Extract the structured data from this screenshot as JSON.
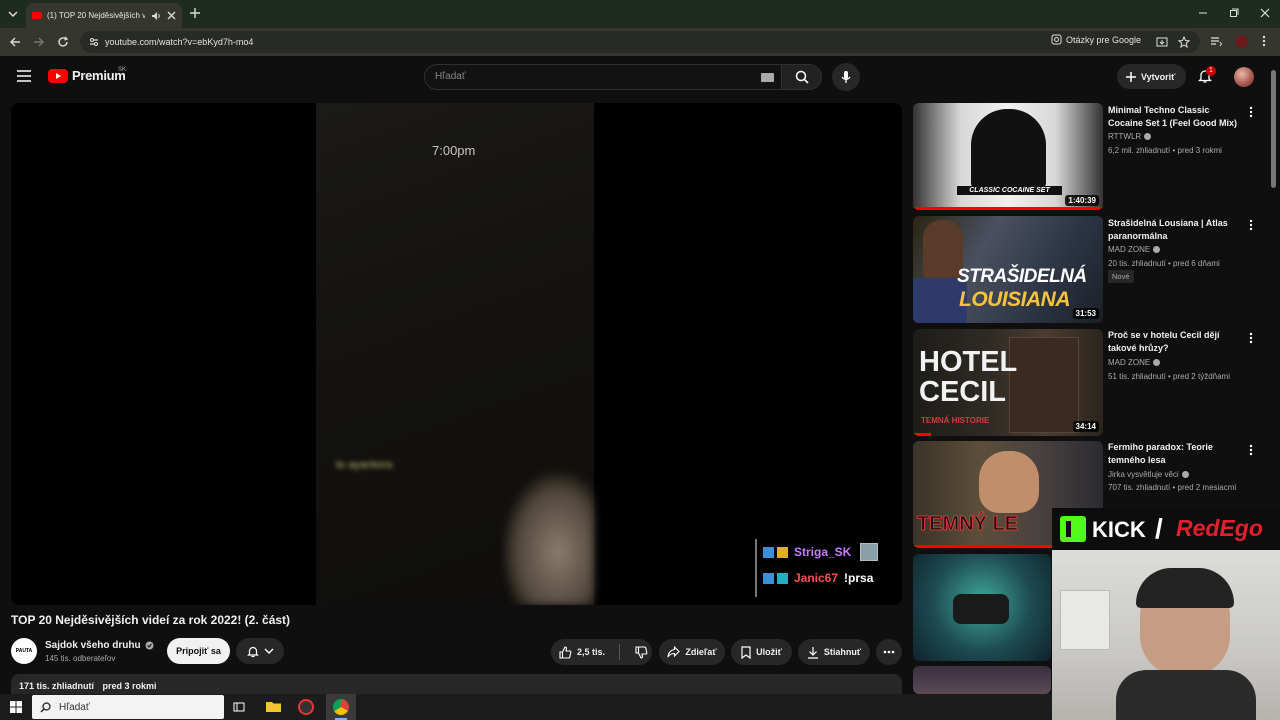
{
  "browser": {
    "tab_title": "(1) TOP 20 Nejděsivějších v",
    "url": "youtube.com/watch?v=ebKyd7h-mo4",
    "google_questions": "Otázky pre Google"
  },
  "masthead": {
    "logo": "Premium",
    "logo_region": "SK",
    "search_placeholder": "Hľadať",
    "create_label": "Vytvoriť",
    "notif_count": "1"
  },
  "video": {
    "clock_text": "7:00pm",
    "blurred_text": "to ayantons"
  },
  "chat": [
    {
      "user": "Striga_SK",
      "user_color": "#c77dff",
      "msg": ""
    },
    {
      "user": "Janic67",
      "user_color": "#ff4d4d",
      "msg": "!prsa"
    }
  ],
  "watch": {
    "title": "TOP 20 Nejděsivějších videí za rok 2022! (2. část)",
    "channel_name": "Sajdok všeho druhu",
    "avatar_text": "PAUTA",
    "subscribers": "145 tis. odberateľov",
    "join_label": "Pripojiť sa",
    "likes": "2,5 tis.",
    "share_label": "Zdieľať",
    "save_label": "Uložiť",
    "download_label": "Stiahnuť",
    "views": "171 tis. zhliadnutí",
    "published": "pred 3 rokmi"
  },
  "sidebar": [
    {
      "title_l1": "Minimal Techno Classic",
      "title_l2": "Cocaine Set 1 (Feel Good Mix)",
      "channel": "RTTWLR",
      "meta": "6,2 mil. zhliadnutí • pred 3 rokmi",
      "duration": "1:40:39",
      "thumb_caption": "CLASSIC COCAINE SET",
      "badge": ""
    },
    {
      "title_l1": "Strašidelná Lousiana | Atlas",
      "title_l2": "paranormálna",
      "channel": "MAD ZONE",
      "meta": "20 tis. zhliadnutí • pred 6 dňami",
      "duration": "31:53",
      "thumb_caption_1": "STRAŠIDELNÁ",
      "thumb_caption_2": "LOUISIANA",
      "badge": "Nové"
    },
    {
      "title_l1": "Proč se v hotelu Cecil dějí",
      "title_l2": "takové hrůzy?",
      "channel": "MAD ZONE",
      "meta": "51 tis. zhliadnutí • pred 2 týždňami",
      "duration": "34:14",
      "thumb_caption_1": "HOTEL",
      "thumb_caption_2": "CECIL",
      "thumb_caption_3": "TEMNÁ HISTORIE",
      "badge": ""
    },
    {
      "title_l1": "Fermiho paradox: Teorie",
      "title_l2": "temného lesa",
      "channel": "Jirka vysvětluje věci",
      "meta": "707 tis. zhliadnutí • pred 2 mesiacmi",
      "duration": "",
      "thumb_caption": "TEMNÝ LE",
      "badge": ""
    }
  ],
  "overlay": {
    "kick": "KICK",
    "slash": "/",
    "redego": "RedEgo"
  },
  "taskbar": {
    "search_placeholder": "Hľadať"
  },
  "colors": {
    "youtube_red": "#ff0000",
    "kick_green": "#53fc18",
    "redego_red": "#e0202b"
  }
}
